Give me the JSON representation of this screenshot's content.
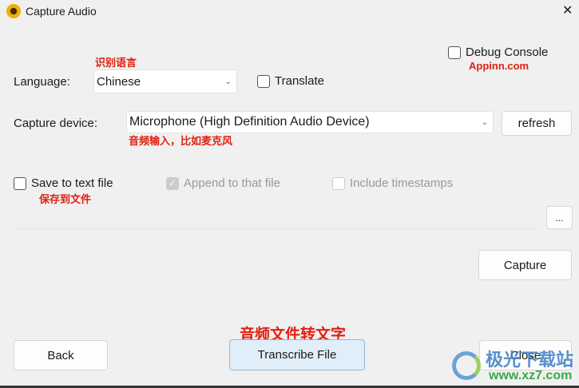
{
  "window": {
    "title": "Capture Audio",
    "close": "✕"
  },
  "language": {
    "label": "Language:",
    "value": "Chinese",
    "note": "识别语言"
  },
  "translate": {
    "label": "Translate",
    "checked": false
  },
  "debug": {
    "label": "Debug Console",
    "note": "Appinn.com",
    "checked": false
  },
  "device": {
    "label": "Capture device:",
    "value": "Microphone (High Definition Audio Device)",
    "note": "音频输入，比如麦克风",
    "refresh": "refresh"
  },
  "save": {
    "label": "Save to text file",
    "note": "保存到文件",
    "append": "Append to that file",
    "timestamps": "Include timestamps",
    "browse": "..."
  },
  "buttons": {
    "capture": "Capture",
    "back": "Back",
    "transcribe": "Transcribe File",
    "transcribe_note": "音频文件转文字",
    "close": "Close"
  },
  "watermark": {
    "name": "极光下载站",
    "url": "www.xz7.com"
  }
}
